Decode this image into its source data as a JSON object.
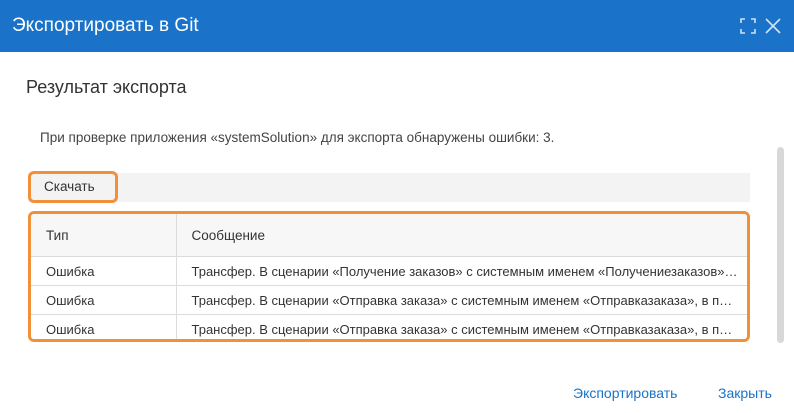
{
  "dialog": {
    "title": "Экспортировать в Git"
  },
  "section": {
    "title": "Результат экспорта",
    "info": "При проверке приложения «systemSolution» для экспорта обнаружены ошибки: 3."
  },
  "toolbar": {
    "download_label": "Скачать"
  },
  "table": {
    "columns": [
      "Тип",
      "Сообщение"
    ],
    "rows": [
      {
        "type": "Ошибка",
        "message": "Трансфер. В сценарии «Получение заказов» с системным именем «Получениезаказов» обнаружены ошибки"
      },
      {
        "type": "Ошибка",
        "message": "Трансфер. В сценарии «Отправка заказа» с системным именем «Отправказаказа», в процессе обнаружены ошибки"
      },
      {
        "type": "Ошибка",
        "message": "Трансфер. В сценарии «Отправка заказа» с системным именем «Отправказаказа», в процессе обнаружены ошибки"
      }
    ]
  },
  "footer": {
    "export_label": "Экспортировать",
    "close_label": "Закрыть"
  },
  "colors": {
    "header_bg": "#1a73c8",
    "highlight": "#f0913a",
    "link": "#1a73c8"
  },
  "icons": {
    "expand": "expand-icon",
    "close": "close-icon"
  }
}
